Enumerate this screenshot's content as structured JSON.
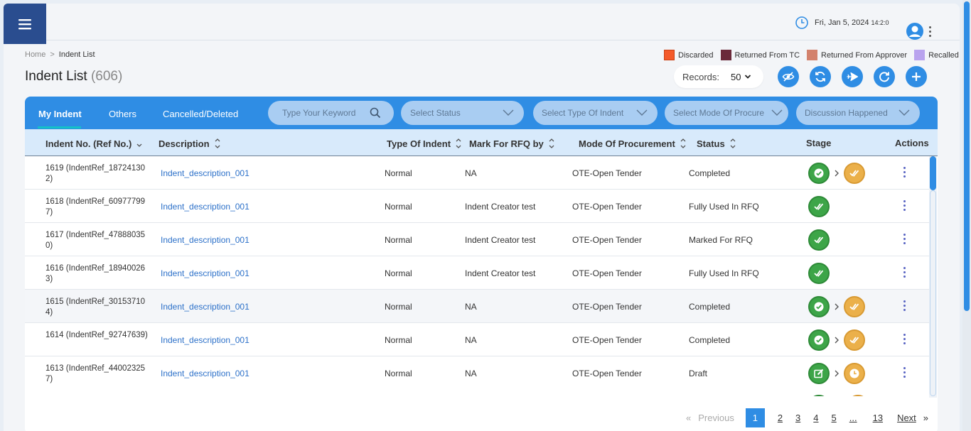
{
  "header": {
    "datetime": "Fri, Jan 5, 2024",
    "time": "14:2:0"
  },
  "breadcrumb": {
    "home": "Home",
    "sep": ">",
    "current": "Indent List"
  },
  "page": {
    "title": "Indent List",
    "count": "(606)"
  },
  "legend": [
    {
      "label": "Discarded",
      "color": "#f45a2a"
    },
    {
      "label": "Returned From TC",
      "color": "#6b2a3a"
    },
    {
      "label": "Returned From Approver",
      "color": "#d3826d"
    },
    {
      "label": "Recalled",
      "color": "#b9a3ee"
    }
  ],
  "records": {
    "label": "Records:",
    "value": "50"
  },
  "toolbar_icons": [
    "eye-off-icon",
    "sync-icon",
    "send-icon",
    "refresh-icon",
    "plus-icon"
  ],
  "tabs": [
    "My Indent",
    "Others",
    "Cancelled/Deleted"
  ],
  "filters": {
    "keyword_placeholder": "Type Your Keyword",
    "status": "Select Status",
    "type": "Select Type Of Indent",
    "mode": "Select Mode Of Procure",
    "discussion": "Discussion Happened"
  },
  "columns": {
    "indent": "Indent No. (Ref No.)",
    "description": "Description",
    "type": "Type Of Indent",
    "rfq": "Mark For RFQ by",
    "mode": "Mode Of Procurement",
    "status": "Status",
    "stage": "Stage",
    "actions": "Actions"
  },
  "rows": [
    {
      "indent": "1619 (IndentRef_187241302)",
      "description": "Indent_description_001",
      "type": "Normal",
      "rfq": "NA",
      "mode": "OTE-Open Tender",
      "status": "Completed",
      "stage": [
        "check-circle",
        "double-check"
      ]
    },
    {
      "indent": "1618 (IndentRef_609777997)",
      "description": "Indent_description_001",
      "type": "Normal",
      "rfq": "Indent Creator test",
      "mode": "OTE-Open Tender",
      "status": "Fully Used In RFQ",
      "stage": [
        "double-check-green"
      ]
    },
    {
      "indent": "1617 (IndentRef_478880350)",
      "description": "Indent_description_001",
      "type": "Normal",
      "rfq": "Indent Creator test",
      "mode": "OTE-Open Tender",
      "status": "Marked For RFQ",
      "stage": [
        "double-check-green"
      ]
    },
    {
      "indent": "1616 (IndentRef_189400263)",
      "description": "Indent_description_001",
      "type": "Normal",
      "rfq": "Indent Creator test",
      "mode": "OTE-Open Tender",
      "status": "Fully Used In RFQ",
      "stage": [
        "double-check-green"
      ]
    },
    {
      "indent": "1615 (IndentRef_301537104)",
      "description": "Indent_description_001",
      "type": "Normal",
      "rfq": "NA",
      "mode": "OTE-Open Tender",
      "status": "Completed",
      "stage": [
        "check-circle",
        "double-check"
      ]
    },
    {
      "indent": "1614 (IndentRef_92747639)",
      "description": "Indent_description_001",
      "type": "Normal",
      "rfq": "NA",
      "mode": "OTE-Open Tender",
      "status": "Completed",
      "stage": [
        "check-circle",
        "double-check"
      ]
    },
    {
      "indent": "1613 (IndentRef_440023257)",
      "description": "Indent_description_001",
      "type": "Normal",
      "rfq": "NA",
      "mode": "OTE-Open Tender",
      "status": "Draft",
      "stage": [
        "edit",
        "clock"
      ]
    }
  ],
  "pagination": {
    "prev": "Previous",
    "pages": [
      "1",
      "2",
      "3",
      "4",
      "5",
      "...",
      "13"
    ],
    "current": "1",
    "next": "Next"
  }
}
